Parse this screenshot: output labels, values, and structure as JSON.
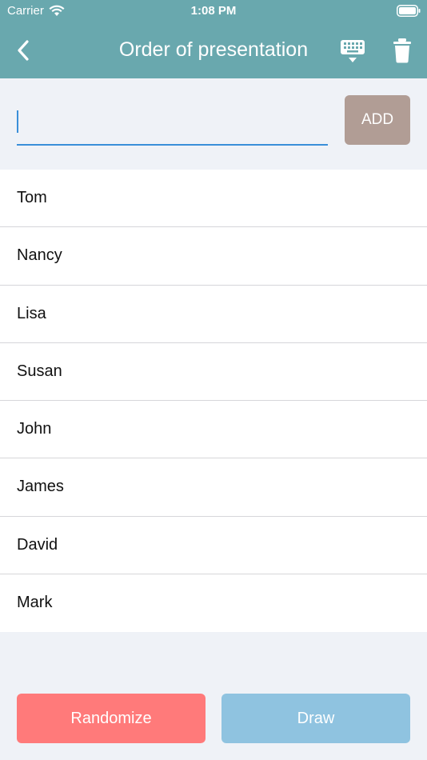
{
  "status_bar": {
    "carrier": "Carrier",
    "time": "1:08 PM"
  },
  "nav": {
    "title": "Order of presentation",
    "back_icon": "chevron-left-icon",
    "keyboard_icon": "keyboard-hide-icon",
    "trash_icon": "trash-icon"
  },
  "input": {
    "value": "",
    "placeholder": "",
    "add_label": "ADD"
  },
  "names": [
    "Tom",
    "Nancy",
    "Lisa",
    "Susan",
    "John",
    "James",
    "David",
    "Mark"
  ],
  "actions": {
    "randomize_label": "Randomize",
    "draw_label": "Draw"
  },
  "colors": {
    "header": "#69A8AE",
    "add_button": "#B19D95",
    "randomize": "#FF7A7A",
    "draw": "#8FC3E0",
    "input_underline": "#3A8FD9",
    "background": "#EFF2F7"
  }
}
